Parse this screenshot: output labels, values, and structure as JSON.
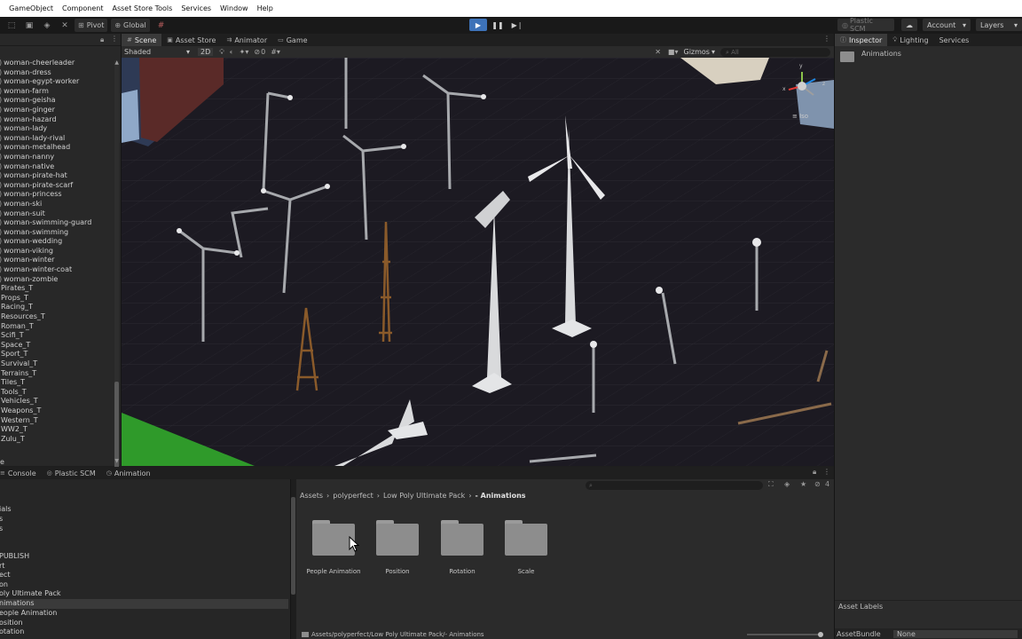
{
  "menu": [
    "s",
    "GameObject",
    "Component",
    "Asset Store Tools",
    "Services",
    "Window",
    "Help"
  ],
  "toolbar": {
    "pivot": "Pivot",
    "global": "Global",
    "plastic_scm": "Plastic SCM",
    "account": "Account",
    "layers": "Layers"
  },
  "hierarchy": {
    "items": [
      "woman-cheerleader",
      "woman-dress",
      "woman-egypt-worker",
      "woman-farm",
      "woman-geisha",
      "woman-ginger",
      "woman-hazard",
      "woman-lady",
      "woman-lady-rival",
      "woman-metalhead",
      "woman-nanny",
      "woman-native",
      "woman-pirate-hat",
      "woman-pirate-scarf",
      "woman-princess",
      "woman-ski",
      "woman-suit",
      "woman-swimming-guard",
      "woman-swimming",
      "woman-wedding",
      "woman-viking",
      "woman-winter",
      "woman-winter-coat",
      "woman-zombie",
      "Pirates_T",
      "Props_T",
      "Racing_T",
      "Resources_T",
      "Roman_T",
      "Scifi_T",
      "Space_T",
      "Sport_T",
      "Survival_T",
      "Terrains_T",
      "Tiles_T",
      "Tools_T",
      "Vehicles_T",
      "Weapons_T",
      "Western_T",
      "WW2_T",
      "Zulu_T"
    ],
    "bottom_partial": "e"
  },
  "scene_tabs": [
    {
      "icon": "#",
      "label": "Scene"
    },
    {
      "icon": "▣",
      "label": "Asset Store"
    },
    {
      "icon": "⇉",
      "label": "Animator"
    },
    {
      "icon": "▭",
      "label": "Game"
    }
  ],
  "scene_toolbar": {
    "shading": "Shaded",
    "mode_2d": "2D",
    "hidden_count": "0",
    "gizmos": "Gizmos",
    "search_prefix": "All"
  },
  "gizmo": {
    "y": "y",
    "x": "x",
    "z": "z",
    "iso": "Iso"
  },
  "inspector": {
    "tabs": [
      "Inspector",
      "Lighting",
      "Services"
    ],
    "folder_name": "Animations",
    "asset_labels": "Asset Labels",
    "asset_bundle_label": "AssetBundle",
    "asset_bundle_value": "None"
  },
  "bottom_tabs": [
    "Console",
    "Plastic SCM",
    "Animation"
  ],
  "project_tree": [
    "ials",
    "s",
    "s",
    "",
    "",
    "PUBLISH",
    "rt",
    "ect",
    "on",
    "oly Ultimate Pack",
    "nimations",
    "eople Animation",
    "osition",
    "otation"
  ],
  "project": {
    "breadcrumb": [
      "Assets",
      "polyperfect",
      "Low Poly Ultimate Pack",
      "- Animations"
    ],
    "folders": [
      "People Animation",
      "Position",
      "Rotation",
      "Scale"
    ],
    "path": "Assets/polyperfect/Low Poly Ultimate Pack/- Animations",
    "hidden_count": "4"
  },
  "colors": {
    "accent": "#3d72b8",
    "viewport_bg": "#1c1a22",
    "panel_bg": "#282828",
    "folder": "#8d8d8d"
  }
}
